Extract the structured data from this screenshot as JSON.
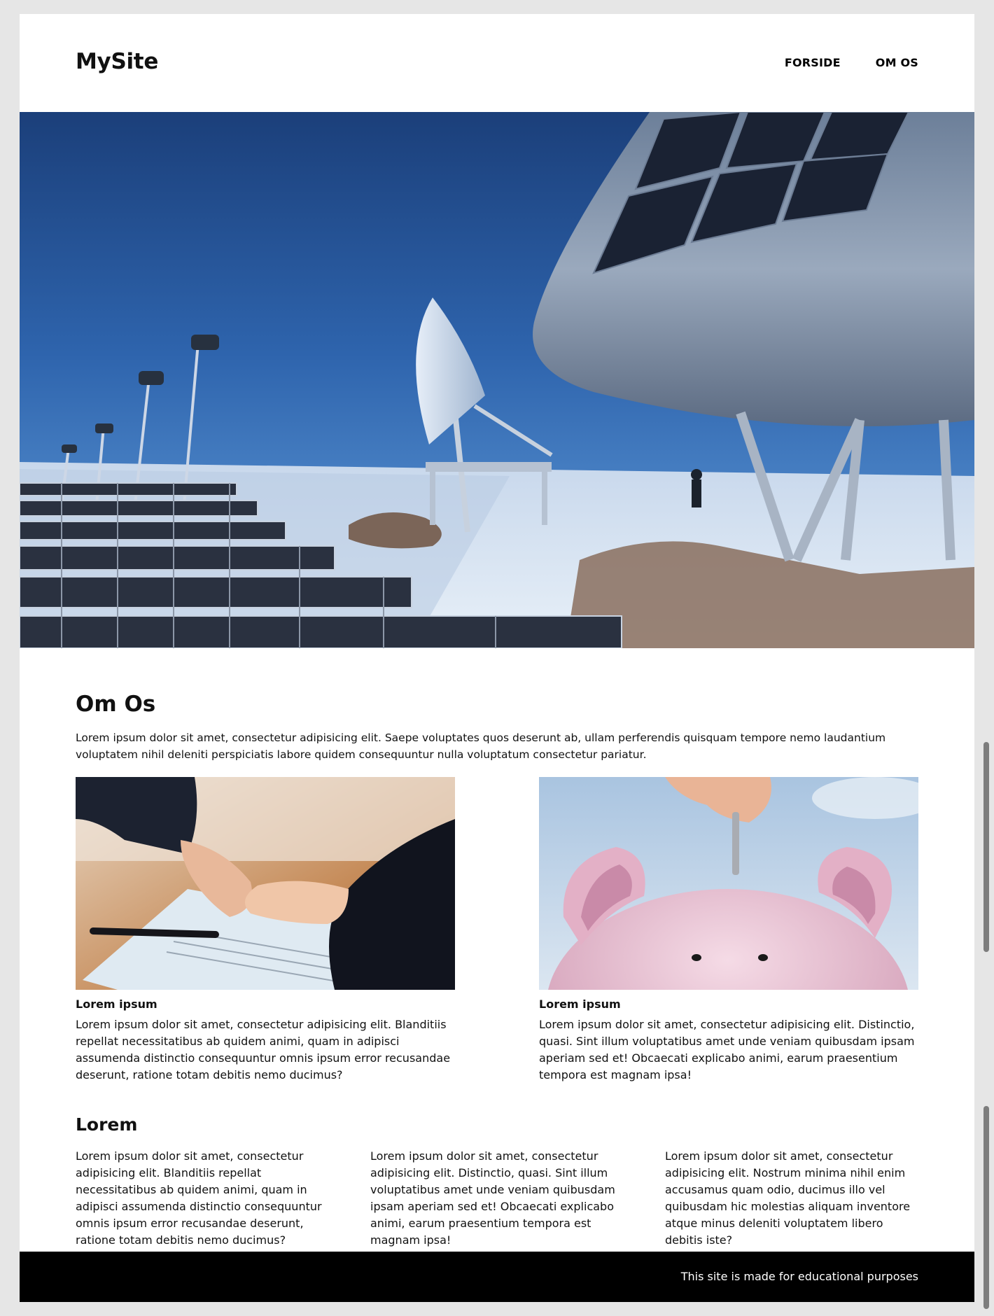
{
  "header": {
    "logo": "MySite",
    "nav": [
      "FORSIDE",
      "OM OS"
    ]
  },
  "hero": {
    "image": "research-station-on-snow-photo"
  },
  "about": {
    "title": "Om Os",
    "intro": "Lorem ipsum dolor sit amet, consectetur adipisicing elit. Saepe voluptates quos deserunt ab, ullam perferendis quisquam tempore nemo laudantium voluptatem nihil deleniti perspiciatis labore quidem consequuntur nulla voluptatum consectetur pariatur."
  },
  "cards": [
    {
      "image": "handshake-photo",
      "title": "Lorem ipsum",
      "text": "Lorem ipsum dolor sit amet, consectetur adipisicing elit. Blanditiis repellat necessitatibus ab quidem animi, quam in adipisci assumenda distinctio consequuntur omnis ipsum error recusandae deserunt, ratione totam debitis nemo ducimus?"
    },
    {
      "image": "piggy-bank-photo",
      "title": "Lorem ipsum",
      "text": "Lorem ipsum dolor sit amet, consectetur adipisicing elit. Distinctio, quasi. Sint illum voluptatibus amet unde veniam quibusdam ipsam aperiam sed et! Obcaecati explicabo animi, earum praesentium tempora est magnam ipsa!"
    }
  ],
  "lorem": {
    "title": "Lorem",
    "columns": [
      "Lorem ipsum dolor sit amet, consectetur adipisicing elit. Blanditiis repellat necessitatibus ab quidem animi, quam in adipisci assumenda distinctio consequuntur omnis ipsum error recusandae deserunt, ratione totam debitis nemo ducimus?",
      "Lorem ipsum dolor sit amet, consectetur adipisicing elit. Distinctio, quasi. Sint illum voluptatibus amet unde veniam quibusdam ipsam aperiam sed et! Obcaecati explicabo animi, earum praesentium tempora est magnam ipsa!",
      "Lorem ipsum dolor sit amet, consectetur adipisicing elit. Nostrum minima nihil enim accusamus quam odio, ducimus illo vel quibusdam hic molestias aliquam inventore atque minus deleniti voluptatem libero debitis iste?"
    ]
  },
  "footer": {
    "text": "This site is made for educational purposes"
  },
  "colors": {
    "background": "#e6e6e6",
    "page": "#ffffff",
    "footer": "#000000",
    "text": "#111111"
  }
}
